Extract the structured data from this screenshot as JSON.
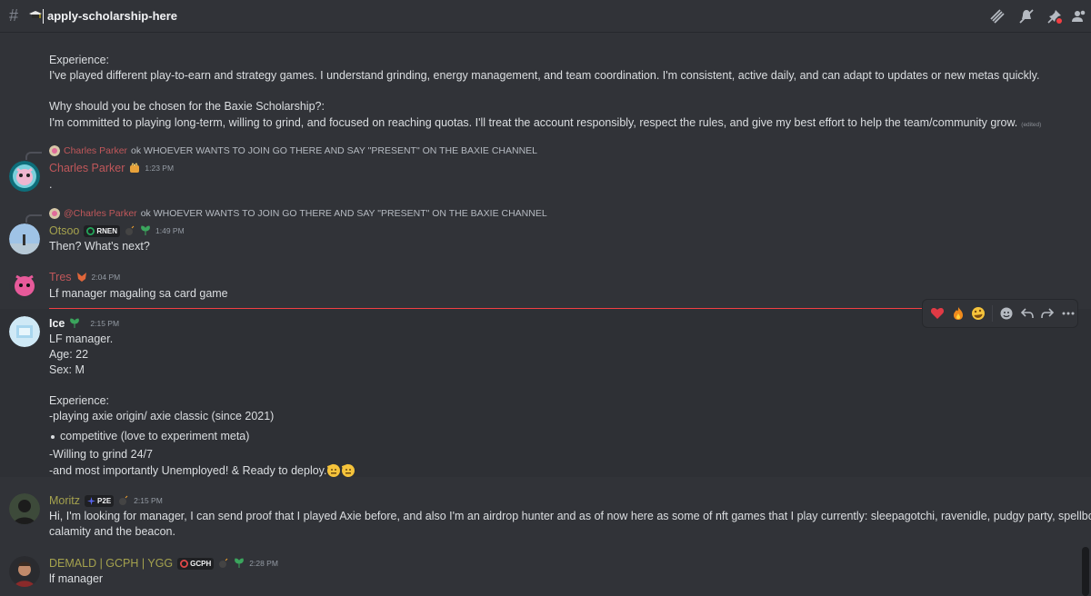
{
  "header": {
    "channel_name": "apply-scholarship-here",
    "icons": [
      "hash-icon",
      "graduation-cap-icon",
      "threads-icon",
      "mute-icon",
      "pin-icon",
      "members-icon"
    ]
  },
  "colors": {
    "background": "#313338",
    "text": "#dbdee1",
    "muted": "#949ba4",
    "red_name": "#c0575a",
    "olive_name": "#a5a24e",
    "new_divider": "#f23f43"
  },
  "messages": {
    "m0": {
      "line1": "Experience:",
      "line2": "I've played different play-to-earn and strategy games. I understand grinding, energy management, and team coordination. I'm consistent, active daily, and can adapt to updates or new metas quickly.",
      "line3": "Why should you be chosen for the Baxie Scholarship?:",
      "line4": "I'm committed to playing long-term, willing to grind, and focused on reaching quotas. I'll treat the account responsibly, respect the rules, and give my best effort to help the team/community grow.",
      "edited": "(edited)"
    },
    "m1": {
      "reply_author": "Charles Parker",
      "reply_text": "ok WHOEVER WANTS TO JOIN GO THERE AND SAY \"PRESENT\" ON THE BAXIE CHANNEL",
      "author": "Charles Parker",
      "time": "1:23 PM",
      "text": "."
    },
    "m2": {
      "reply_author": "@Charles Parker",
      "reply_text": "ok WHOEVER WANTS TO JOIN GO THERE AND SAY \"PRESENT\" ON THE BAXIE CHANNEL",
      "author": "Otsoo",
      "tag": "RNEN",
      "time": "1:49 PM",
      "text": "Then? What's next?"
    },
    "m3": {
      "author": "Tres",
      "time": "2:04 PM",
      "text": "Lf manager magaling sa card game"
    },
    "m4": {
      "author": "Ice",
      "time": "2:15 PM",
      "lines": [
        "LF manager.",
        "Age: 22",
        "Sex: M",
        "Experience:",
        "-playing axie origin/ axie classic (since 2021)",
        "competitive (love to experiment meta)",
        "-Willing to grind 24/7",
        "-and most importantly Unemployed!  & Ready to deploy."
      ]
    },
    "m5": {
      "author": "Moritz",
      "tag": "P2E",
      "time": "2:15 PM",
      "line1": "Hi, I'm looking for manager, I can send proof that I played Axie before, and also I'm an airdrop hunter and as of now here as some of nft games that I play currently: sleepagotchi, ravenidle, pudgy party, spellborne,",
      "line2": "calamity and the beacon."
    },
    "m6": {
      "author": "DEMALD | GCPH | YGG",
      "tag": "GCPH",
      "time": "2:28 PM",
      "text": "lf manager"
    }
  },
  "toolbar": {
    "reactions": [
      "heart",
      "fire",
      "rofl"
    ],
    "buttons": [
      "add-reaction",
      "reply",
      "forward",
      "more"
    ]
  }
}
